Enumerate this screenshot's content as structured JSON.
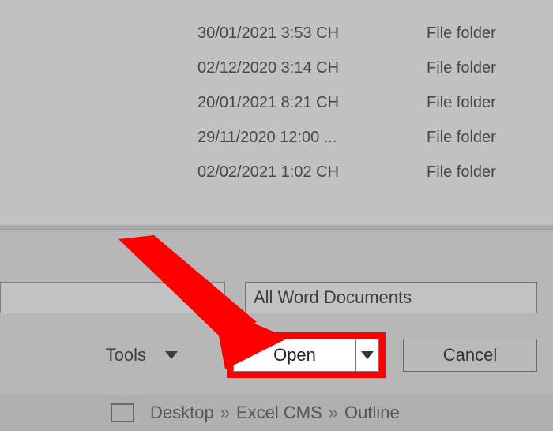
{
  "files": [
    {
      "date": "30/01/2021 3:53 CH",
      "type": "File folder"
    },
    {
      "date": "02/12/2020 3:14 CH",
      "type": "File folder"
    },
    {
      "date": "20/01/2021 8:21 CH",
      "type": "File folder"
    },
    {
      "date": "29/11/2020 12:00 ...",
      "type": "File folder"
    },
    {
      "date": "02/02/2021 1:02 CH",
      "type": "File folder"
    }
  ],
  "footer": {
    "filename_value": "",
    "filter_label": "All Word Documents",
    "tools_label": "Tools",
    "open_label": "Open",
    "cancel_label": "Cancel"
  },
  "breadcrumb": {
    "seg1": "Desktop",
    "seg2": "Excel CMS",
    "seg3": "Outline",
    "sep": "»"
  }
}
